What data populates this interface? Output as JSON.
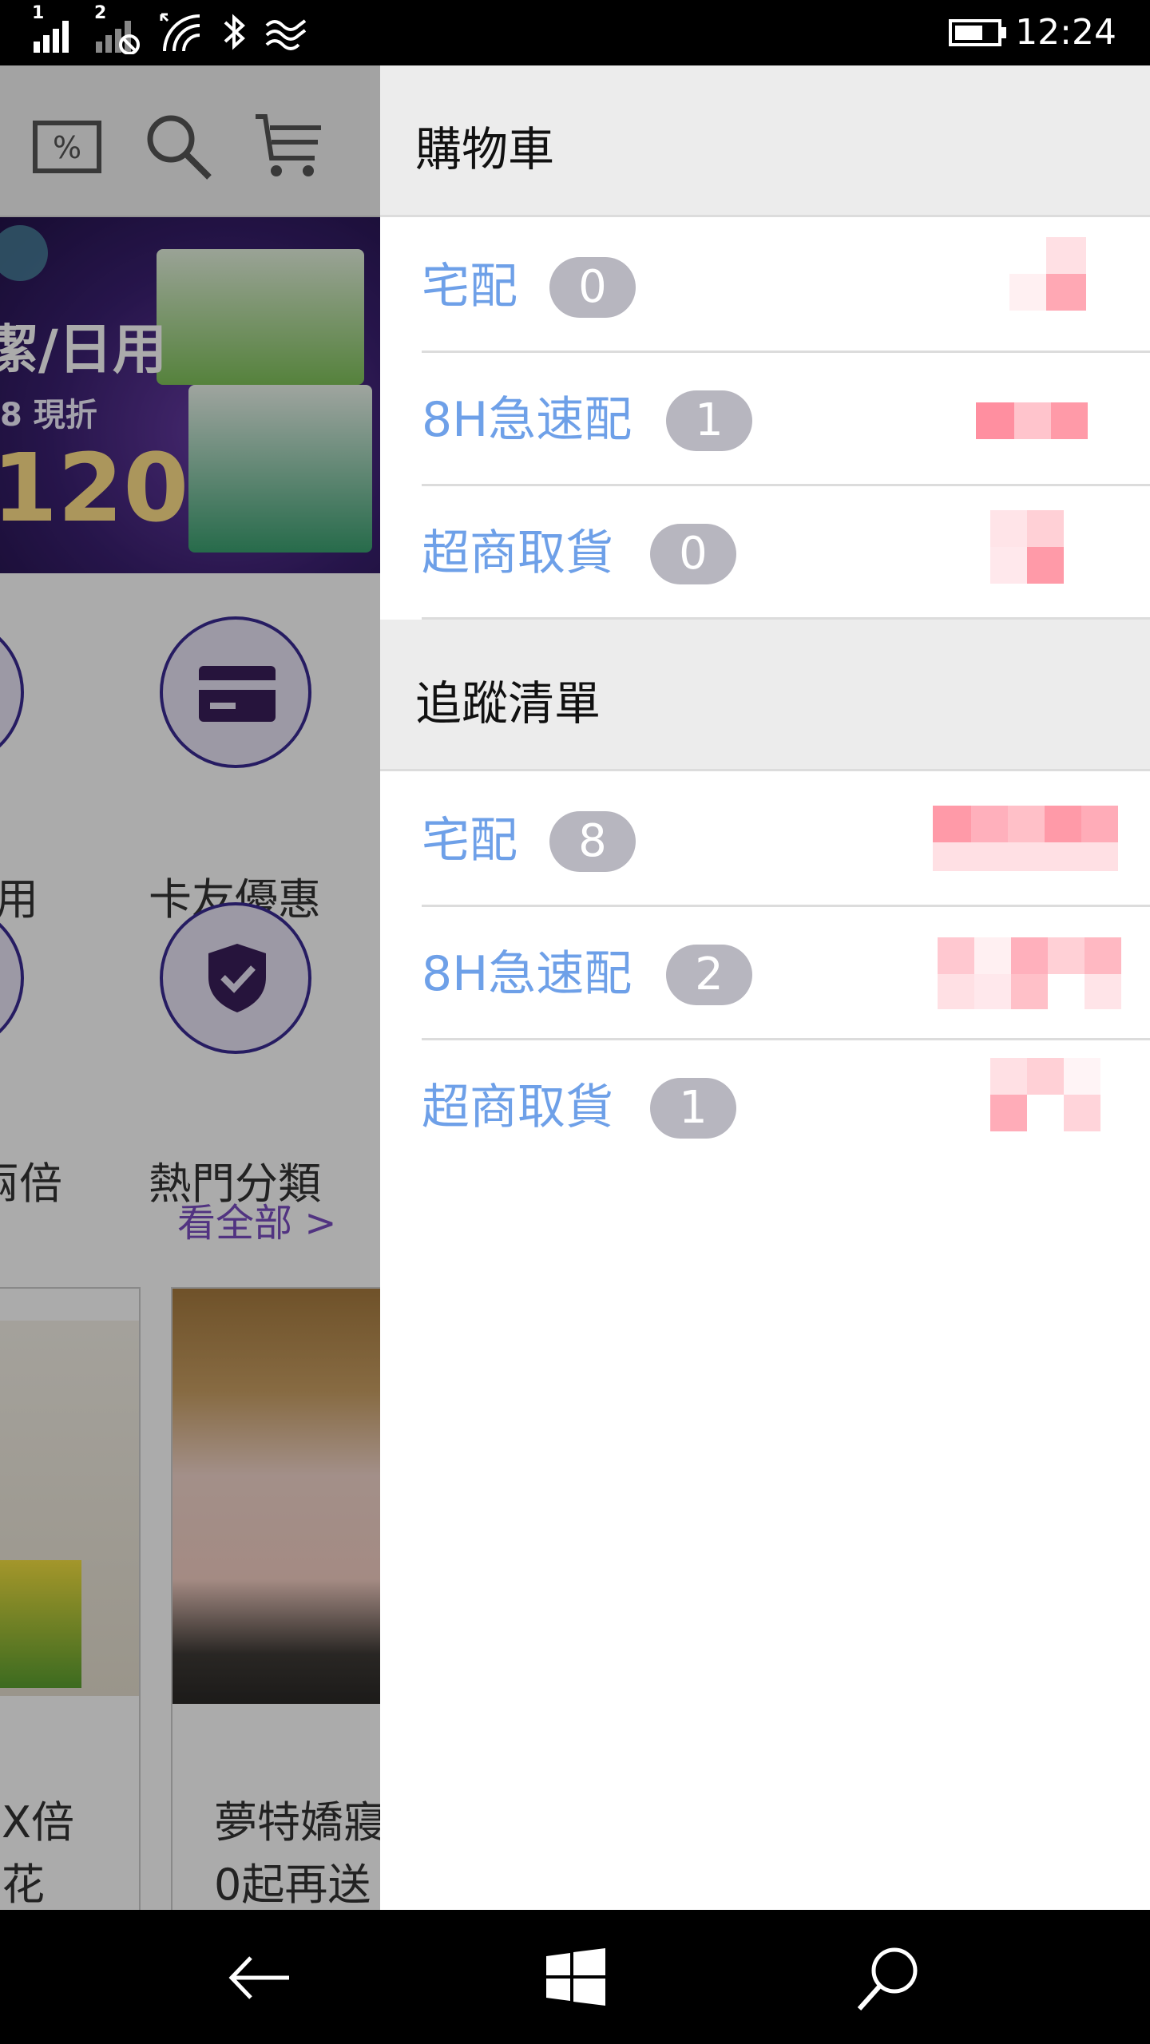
{
  "status_bar": {
    "time": "12:24",
    "sim1_label": "1",
    "sim2_label": "2",
    "icons": [
      "signal-icon",
      "signal-no-sim-icon",
      "wifi-icon",
      "bluetooth-icon",
      "data-saver-icon",
      "battery-icon"
    ]
  },
  "app": {
    "header_icons": [
      "discount-icon",
      "search-icon",
      "cart-icon"
    ],
    "banner": {
      "line1": "潔/日用",
      "line2": "8 現折",
      "line3": "120"
    },
    "categories": [
      {
        "label": "卡友優惠",
        "icon": "credit-card-icon"
      },
      {
        "label": "熱門分類",
        "icon": "shield-check-icon"
      }
    ],
    "partial_categories": [
      "用",
      "兩倍"
    ],
    "see_all": "看全部 >",
    "products": [
      {
        "title_line1": "X倍",
        "title_line2": "花"
      },
      {
        "title_line1": "夢特嬌寢",
        "title_line2": "0起再送"
      }
    ]
  },
  "cart_panel": {
    "title": "購物車",
    "rows": [
      {
        "label": "宅配",
        "count": "0"
      },
      {
        "label": "8H急速配",
        "count": "1"
      },
      {
        "label": "超商取貨",
        "count": "0"
      }
    ]
  },
  "wishlist_panel": {
    "title": "追蹤清單",
    "rows": [
      {
        "label": "宅配",
        "count": "8"
      },
      {
        "label": "8H急速配",
        "count": "2"
      },
      {
        "label": "超商取貨",
        "count": "1"
      }
    ]
  },
  "nav_bar": {
    "buttons": [
      "back-icon",
      "windows-icon",
      "search-icon"
    ]
  },
  "colors": {
    "accent_blue": "#6ea0e8",
    "badge_gray": "#b7b6bf",
    "section_bg": "#ececec",
    "purple": "#3a2a92",
    "pink_pixel": "#ff8fa0"
  }
}
